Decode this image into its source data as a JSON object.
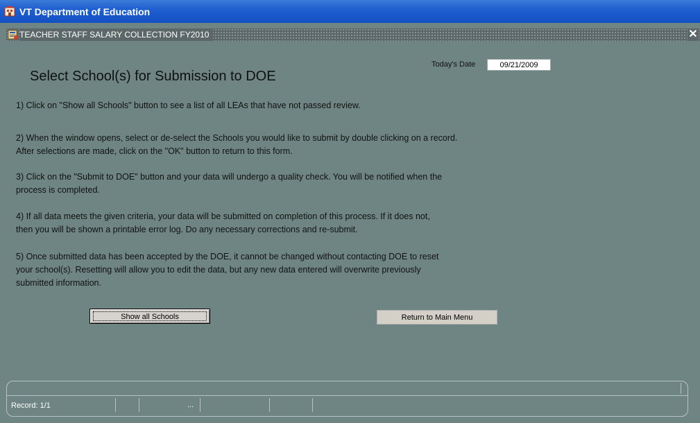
{
  "app": {
    "title": "VT Department of Education",
    "icon": "doe-app-icon"
  },
  "form": {
    "title": "TEACHER STAFF SALARY COLLECTION FY2010",
    "close_icon": "close-icon"
  },
  "page_title": "Select School(s) for Submission to DOE",
  "todays_date": {
    "label": "Today's Date",
    "value": "09/21/2009"
  },
  "instructions": [
    {
      "lines": [
        "1)  Click on \"Show all Schools\" button to see a list of all LEAs that have not passed review."
      ]
    },
    {
      "lines": [
        "2) When the window opens, select or de-select the Schools you would like to submit by double clicking on a record.",
        "    After selections are made, click on the \"OK\" button to return to this form."
      ]
    },
    {
      "lines": [
        "3) Click on the \"Submit to DOE\"  button and your data will undergo a quality check.   You will be notified when the",
        "    process is completed."
      ]
    },
    {
      "lines": [
        "4) If all data meets the given criteria, your data will be submitted on completion of this process.  If it  does not,",
        "    then you will be shown a printable error log.  Do any necessary corrections and re-submit."
      ]
    },
    {
      "lines": [
        "5) Once submitted data has been accepted by the DOE, it cannot be changed without contacting DOE to reset",
        "    your school(s).  Resetting will allow you to edit the data, but any new data entered will overwrite previously",
        "    submitted information."
      ]
    }
  ],
  "buttons": {
    "show_all_schools": "Show all Schools",
    "return_main_menu": "Return to Main Menu"
  },
  "status": {
    "record": "Record: 1/1",
    "ellipsis": "..."
  },
  "colors": {
    "background": "#6f8584",
    "titlebar": "#1f5fd0",
    "form_titlebar": "#5b6768"
  }
}
